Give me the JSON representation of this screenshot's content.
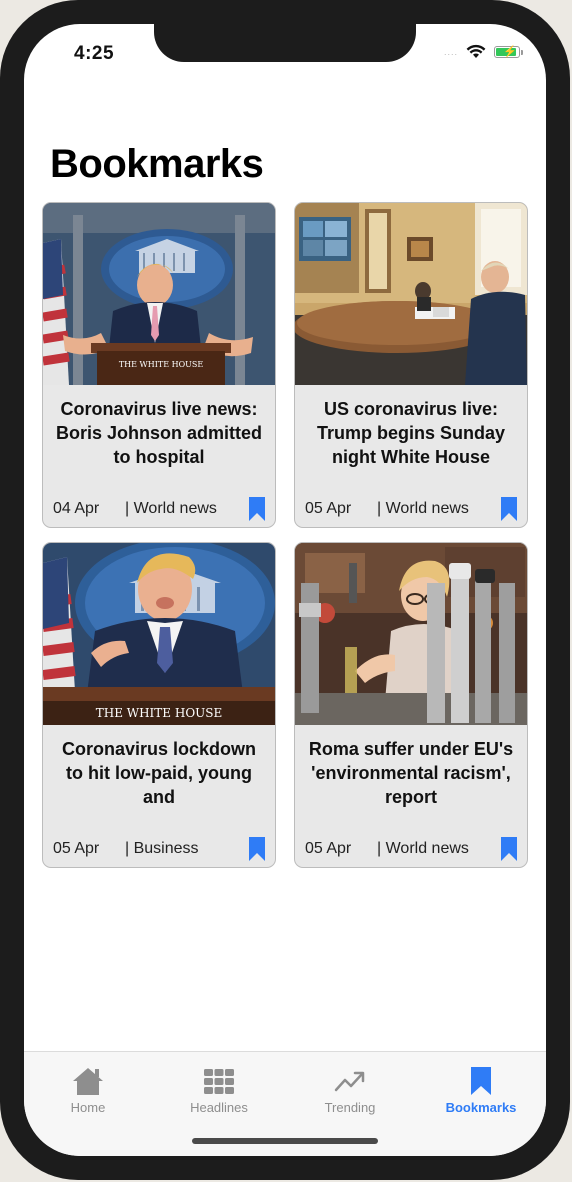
{
  "status_bar": {
    "time": "4:25",
    "signal_dots": "....",
    "wifi_icon": "wifi-icon",
    "battery_level": 0.9
  },
  "page": {
    "title": "Bookmarks"
  },
  "colors": {
    "accent": "#2f7cf6",
    "card_background": "#e8e8e8"
  },
  "articles": [
    {
      "title": "Coronavirus live news: Boris Johnson admitted to hospital",
      "date": "04 Apr",
      "category": "| World news",
      "image": "press-briefing-photo",
      "bookmark_icon": "bookmark-icon"
    },
    {
      "title": "US coronavirus live: Trump begins Sunday night White House",
      "date": "05 Apr",
      "category": "| World news",
      "image": "office-meeting-photo",
      "bookmark_icon": "bookmark-icon"
    },
    {
      "title": "Coronavirus lockdown to hit low-paid, young and",
      "date": "05 Apr",
      "category": "| Business",
      "image": "white-house-podium-photo",
      "bookmark_icon": "bookmark-icon"
    },
    {
      "title": "Roma suffer under EU's 'environmental racism', report",
      "date": "05 Apr",
      "category": "| World news",
      "image": "bar-beer-tap-photo",
      "bookmark_icon": "bookmark-icon"
    }
  ],
  "podium_texts": {
    "press": "THE WHITE HOUSE",
    "podium": "THE WHITE HOUSE"
  },
  "tabs": [
    {
      "label": "Home",
      "icon": "home-icon",
      "active": false
    },
    {
      "label": "Headlines",
      "icon": "grid-icon",
      "active": false
    },
    {
      "label": "Trending",
      "icon": "trending-icon",
      "active": false
    },
    {
      "label": "Bookmarks",
      "icon": "bookmark-icon",
      "active": true
    }
  ]
}
